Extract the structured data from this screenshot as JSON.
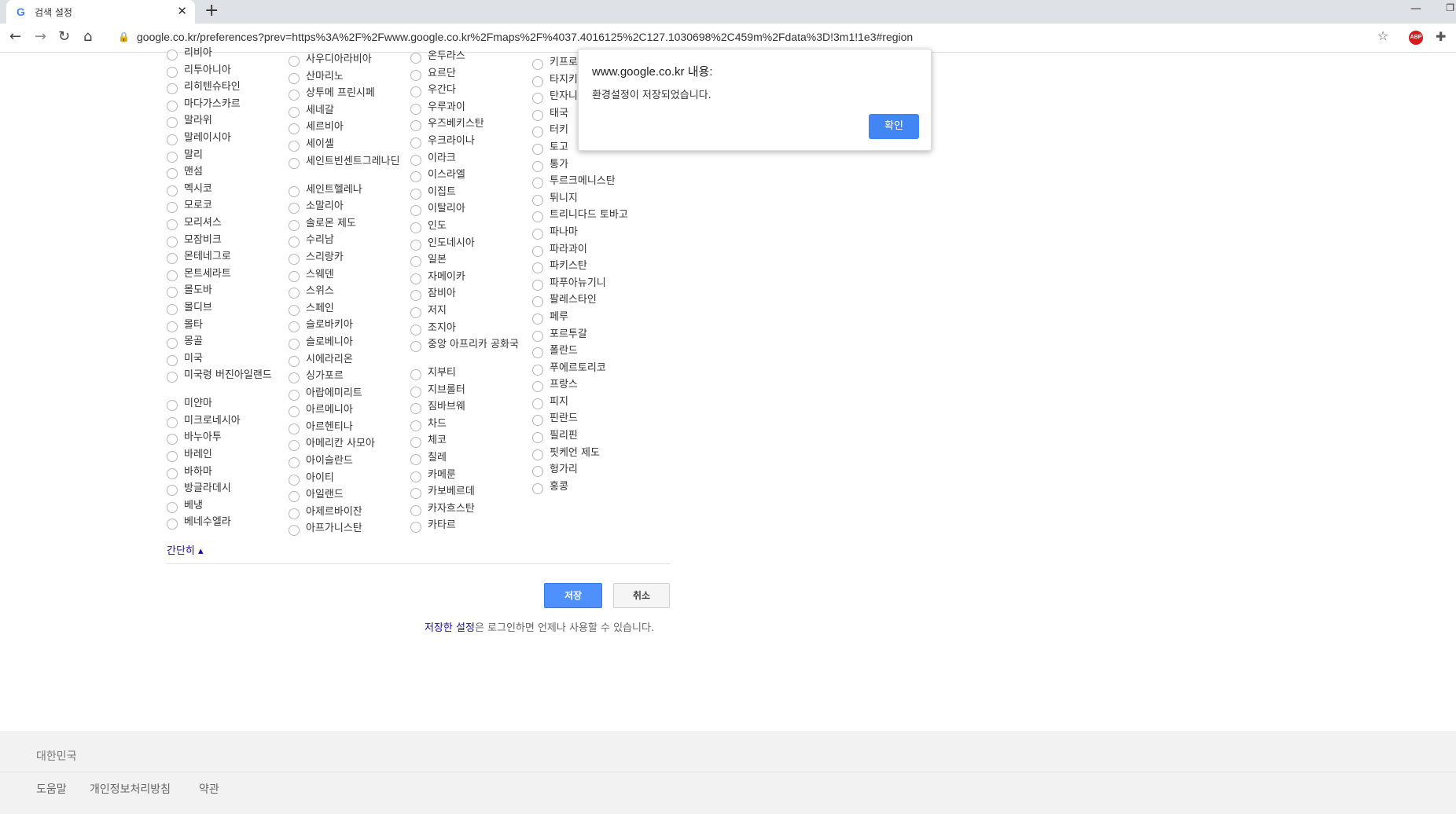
{
  "browser": {
    "tab_title": "검색 설정",
    "new_tab": "+",
    "url": "google.co.kr/preferences?prev=https%3A%2F%2Fwww.google.co.kr%2Fmaps%2F%4037.4016125%2C127.1030698%2C459m%2Fdata%3D!3m1!1e3#region",
    "extension_abp": "ABP"
  },
  "columns": [
    [
      "리비아",
      "리투아니아",
      "리히텐슈타인",
      "마다가스카르",
      "말라위",
      "말레이시아",
      "말리",
      "맨섬",
      "멕시코",
      "모로코",
      "모리셔스",
      "모잠비크",
      "몬테네그로",
      "몬트세라트",
      "몰도바",
      "몰디브",
      "몰타",
      "몽골",
      "미국",
      "미국령 버진아일랜드",
      "미얀마",
      "미크로네시아",
      "바누아투",
      "바레인",
      "바하마",
      "방글라데시",
      "베냉",
      "베네수엘라"
    ],
    [
      "사우디아라비아",
      "산마리노",
      "상투메 프린시페",
      "세네갈",
      "세르비아",
      "세이셸",
      "세인트빈센트그레나딘",
      "세인트헬레나",
      "소말리아",
      "솔로몬 제도",
      "수리남",
      "스리랑카",
      "스웨덴",
      "스위스",
      "스페인",
      "슬로바키아",
      "슬로베니아",
      "시에라리온",
      "싱가포르",
      "아랍에미리트",
      "아르메니아",
      "아르헨티나",
      "아메리칸 사모아",
      "아이슬란드",
      "아이티",
      "아일랜드",
      "아제르바이잔",
      "아프가니스탄"
    ],
    [
      "온두라스",
      "요르단",
      "우간다",
      "우루과이",
      "우즈베키스탄",
      "우크라이나",
      "이라크",
      "이스라엘",
      "이집트",
      "이탈리아",
      "인도",
      "인도네시아",
      "일본",
      "자메이카",
      "잠비아",
      "저지",
      "조지아",
      "중앙 아프리카 공화국",
      "지부티",
      "지브롤터",
      "짐바브웨",
      "차드",
      "체코",
      "칠레",
      "카메룬",
      "카보베르데",
      "카자흐스탄",
      "카타르"
    ],
    [
      "키프로",
      "타지키",
      "탄자니",
      "태국",
      "터키",
      "토고",
      "통가",
      "투르크메니스탄",
      "튀니지",
      "트리니다드 토바고",
      "파나마",
      "파라과이",
      "파키스탄",
      "파푸아뉴기니",
      "팔레스타인",
      "페루",
      "포르투갈",
      "폴란드",
      "푸에르토리코",
      "프랑스",
      "피지",
      "핀란드",
      "필리핀",
      "핏케언 제도",
      "헝가리",
      "홍콩"
    ]
  ],
  "collapse_link": "간단히 ▴",
  "buttons": {
    "save": "저장",
    "cancel": "취소"
  },
  "saved_note": {
    "link": "저장한 설정",
    "text": "은 로그인하면 언제나 사용할 수 있습니다."
  },
  "footer": {
    "country": "대한민국",
    "links": [
      "도움말",
      "개인정보처리방침",
      "약관"
    ]
  },
  "dialog": {
    "title": "www.google.co.kr 내용:",
    "message": "환경설정이 저장되었습니다.",
    "ok": "확인"
  }
}
